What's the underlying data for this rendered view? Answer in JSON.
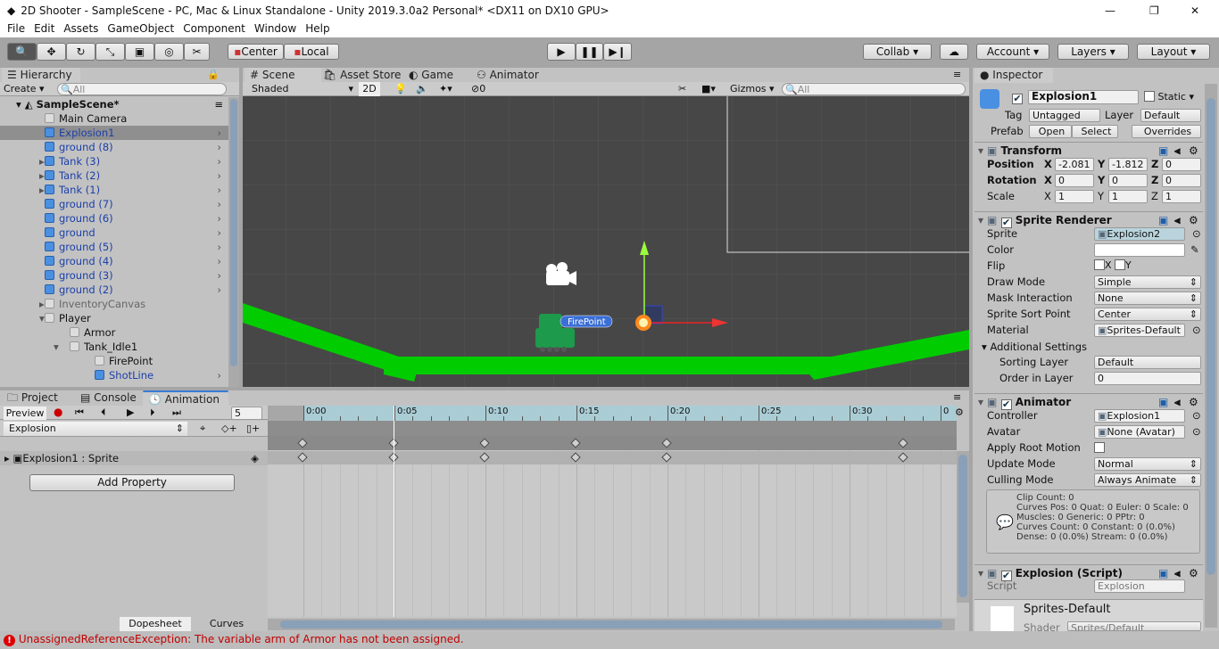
{
  "window": {
    "title": "2D Shooter - SampleScene - PC, Mac & Linux Standalone - Unity 2019.3.0a2 Personal* <DX11 on DX10 GPU>",
    "controls": [
      "—",
      "❐",
      "✕"
    ]
  },
  "menu": [
    "File",
    "Edit",
    "Assets",
    "GameObject",
    "Component",
    "Window",
    "Help"
  ],
  "toolbar": {
    "tools": [
      "hand-tool",
      "move-tool",
      "rotate-tool",
      "scale-tool",
      "rect-tool",
      "transform-tool",
      "custom-tool"
    ],
    "pivot": "Center",
    "space": "Local",
    "collab": "Collab",
    "account": "Account",
    "layers": "Layers",
    "layout": "Layout"
  },
  "hierarchy": {
    "tab": "Hierarchy",
    "create": "Create",
    "search_placeholder": "All",
    "scene": "SampleScene*",
    "items": [
      {
        "label": "Main Camera",
        "indent": 1,
        "kind": "plain",
        "arrow": false
      },
      {
        "label": "Explosion1",
        "indent": 1,
        "kind": "prefab",
        "arrow": false,
        "selected": true,
        "chev": true
      },
      {
        "label": "ground (8)",
        "indent": 1,
        "kind": "prefab",
        "arrow": false,
        "chev": true
      },
      {
        "label": "Tank (3)",
        "indent": 1,
        "kind": "prefab",
        "arrow": true,
        "chev": true
      },
      {
        "label": "Tank (2)",
        "indent": 1,
        "kind": "prefab",
        "arrow": true,
        "chev": true
      },
      {
        "label": "Tank (1)",
        "indent": 1,
        "kind": "prefab",
        "arrow": true,
        "chev": true
      },
      {
        "label": "ground (7)",
        "indent": 1,
        "kind": "prefab",
        "arrow": false,
        "chev": true
      },
      {
        "label": "ground (6)",
        "indent": 1,
        "kind": "prefab",
        "arrow": false,
        "chev": true
      },
      {
        "label": "ground",
        "indent": 1,
        "kind": "prefab",
        "arrow": false,
        "chev": true
      },
      {
        "label": "ground (5)",
        "indent": 1,
        "kind": "prefab",
        "arrow": false,
        "chev": true
      },
      {
        "label": "ground (4)",
        "indent": 1,
        "kind": "prefab",
        "arrow": false,
        "chev": true
      },
      {
        "label": "ground (3)",
        "indent": 1,
        "kind": "prefab",
        "arrow": false,
        "chev": true
      },
      {
        "label": "ground (2)",
        "indent": 1,
        "kind": "prefab",
        "arrow": false,
        "chev": true
      },
      {
        "label": "InventoryCanvas",
        "indent": 1,
        "kind": "inactive",
        "arrow": true
      },
      {
        "label": "Player",
        "indent": 1,
        "kind": "plain",
        "arrow": "open"
      },
      {
        "label": "Armor",
        "indent": 2,
        "kind": "plain",
        "arrow": false
      },
      {
        "label": "Tank_Idle1",
        "indent": 2,
        "kind": "plain",
        "arrow": "open"
      },
      {
        "label": "FirePoint",
        "indent": 3,
        "kind": "plain",
        "arrow": false
      },
      {
        "label": "ShotLine",
        "indent": 3,
        "kind": "prefab",
        "arrow": false,
        "chev": true
      }
    ]
  },
  "scene": {
    "tabs": [
      "Scene",
      "Asset Store",
      "Game",
      "Animator"
    ],
    "shading": "Shaded",
    "mode2d": "2D",
    "hidden_count": "0",
    "gizmos": "Gizmos",
    "search_placeholder": "All",
    "firepoint_label": "FirePoint",
    "colors": {
      "ground": "#00cc00",
      "tank": "#1d9a4b",
      "background": "#474747"
    }
  },
  "inspector": {
    "tab": "Inspector",
    "name": "Explosion1",
    "static": "Static",
    "tag_label": "Tag",
    "tag": "Untagged",
    "layer_label": "Layer",
    "layer": "Default",
    "prefab_label": "Prefab",
    "open": "Open",
    "select": "Select",
    "overrides": "Overrides",
    "transform": {
      "title": "Transform",
      "rows": [
        {
          "label": "Position",
          "x": "-2.081",
          "y": "-1.812",
          "z": "0"
        },
        {
          "label": "Rotation",
          "x": "0",
          "y": "0",
          "z": "0"
        },
        {
          "label": "Scale",
          "x": "1",
          "y": "1",
          "z": "1"
        }
      ]
    },
    "sprite_renderer": {
      "title": "Sprite Renderer",
      "fields": [
        {
          "label": "Sprite",
          "value": "Explosion2",
          "type": "obj"
        },
        {
          "label": "Color",
          "value": "",
          "type": "color"
        },
        {
          "label": "Flip",
          "value": "",
          "type": "flip"
        },
        {
          "label": "Draw Mode",
          "value": "Simple",
          "type": "dd"
        },
        {
          "label": "Mask Interaction",
          "value": "None",
          "type": "dd"
        },
        {
          "label": "Sprite Sort Point",
          "value": "Center",
          "type": "dd"
        },
        {
          "label": "Material",
          "value": "Sprites-Default",
          "type": "obj"
        }
      ],
      "additional": "Additional Settings",
      "sorting_layer_label": "Sorting Layer",
      "sorting_layer": "Default",
      "order_label": "Order in Layer",
      "order": "0",
      "flip_x": "X",
      "flip_y": "Y"
    },
    "animator": {
      "title": "Animator",
      "fields": [
        {
          "label": "Controller",
          "value": "Explosion1",
          "type": "obj"
        },
        {
          "label": "Avatar",
          "value": "None (Avatar)",
          "type": "obj"
        },
        {
          "label": "Apply Root Motion",
          "value": "",
          "type": "check"
        },
        {
          "label": "Update Mode",
          "value": "Normal",
          "type": "dd"
        },
        {
          "label": "Culling Mode",
          "value": "Always Animate",
          "type": "dd"
        }
      ],
      "info": [
        "Clip Count: 0",
        "Curves Pos: 0 Quat: 0 Euler: 0 Scale: 0",
        "Muscles: 0 Generic: 0 PPtr: 0",
        "Curves Count: 0 Constant: 0 (0.0%)",
        "Dense: 0 (0.0%) Stream: 0 (0.0%)"
      ]
    },
    "script": {
      "title": "Explosion (Script)",
      "label": "Script",
      "value": "Explosion"
    },
    "material": {
      "name": "Sprites-Default",
      "shader_label": "Shader",
      "shader": "Sprites/Default"
    }
  },
  "bottom": {
    "tabs": [
      "Project",
      "Console",
      "Animation"
    ],
    "preview": "Preview",
    "frame": "5",
    "clip": "Explosion",
    "property": "Explosion1 : Sprite",
    "add_property": "Add Property",
    "dopesheet": "Dopesheet",
    "curves": "Curves",
    "ruler": [
      "0:00",
      "0:05",
      "0:10",
      "0:15",
      "0:20",
      "0:25",
      "0:30",
      "0"
    ],
    "keyframes_frames": [
      0,
      5,
      10,
      15,
      20,
      33
    ],
    "current_frame": 5
  },
  "status": {
    "message": "UnassignedReferenceException: The variable arm of Armor has not been assigned.",
    "color": "#c00000"
  }
}
